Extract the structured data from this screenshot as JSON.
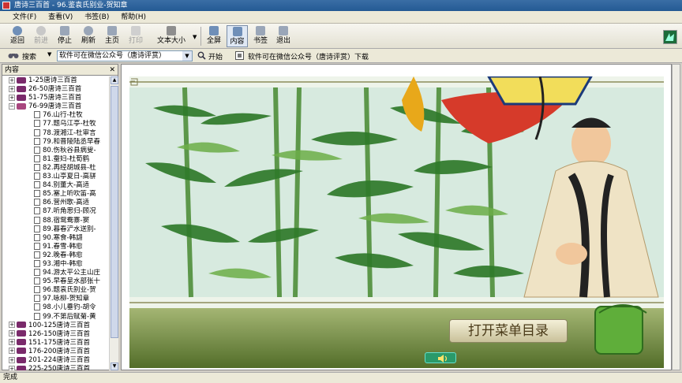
{
  "window": {
    "title": "唐诗三百首 - 96.鉴袁氏别业-贺知章"
  },
  "menu": [
    "文件(F)",
    "查看(V)",
    "书签(B)",
    "帮助(H)"
  ],
  "toolbar": {
    "back": "返回",
    "forward": "前进",
    "stop": "停止",
    "refresh": "刷新",
    "home": "主页",
    "print": "打印",
    "text_size": "文本大小",
    "fullscreen": "全屏",
    "contents": "内容",
    "bookmark": "书签",
    "exit": "退出"
  },
  "searchbar": {
    "search_label": "搜索",
    "combo_value": "软件可在微信公众号（唐诗评赏）",
    "start_label": "开始",
    "download_text": "软件可在微信公众号（唐诗评赏）下载"
  },
  "panel": {
    "title": "内容",
    "close": "✕"
  },
  "tree": [
    {
      "kind": "book",
      "label": "1-25唐诗三百首",
      "expanded": false
    },
    {
      "kind": "book",
      "label": "26-50唐诗三百首",
      "expanded": false
    },
    {
      "kind": "book",
      "label": "51-75唐诗三百首",
      "expanded": false
    },
    {
      "kind": "book",
      "label": "76-99唐诗三百首",
      "expanded": true
    },
    {
      "kind": "leaf",
      "label": "76.山行-杜牧"
    },
    {
      "kind": "leaf",
      "label": "77.题乌江亭-杜牧"
    },
    {
      "kind": "leaf",
      "label": "78.渡湘江-杜审言"
    },
    {
      "kind": "leaf",
      "label": "79.和晋陵陆丞早春"
    },
    {
      "kind": "leaf",
      "label": "80.伤秋谷县病叟-"
    },
    {
      "kind": "leaf",
      "label": "81.蚕妇-杜荀鹤"
    },
    {
      "kind": "leaf",
      "label": "82.再经胡城县-杜"
    },
    {
      "kind": "leaf",
      "label": "83.山亭夏日-高骈"
    },
    {
      "kind": "leaf",
      "label": "84.别董大-高适"
    },
    {
      "kind": "leaf",
      "label": "85.塞上听吹笛-高"
    },
    {
      "kind": "leaf",
      "label": "86.营州歌-高适"
    },
    {
      "kind": "leaf",
      "label": "87.听角思归-顾况"
    },
    {
      "kind": "leaf",
      "label": "88.宿鸳鸯寨-窦"
    },
    {
      "kind": "leaf",
      "label": "89.暮春浐水送别-"
    },
    {
      "kind": "leaf",
      "label": "90.寒食-韩翃"
    },
    {
      "kind": "leaf",
      "label": "91.春雪-韩愈"
    },
    {
      "kind": "leaf",
      "label": "92.晚春-韩愈"
    },
    {
      "kind": "leaf",
      "label": "93.湘中-韩愈"
    },
    {
      "kind": "leaf",
      "label": "94.游太平公主山庄"
    },
    {
      "kind": "leaf",
      "label": "95.早春呈水部张十"
    },
    {
      "kind": "leaf",
      "label": "96.题袁氏别业-贺"
    },
    {
      "kind": "leaf",
      "label": "97.咏柳-贺知章"
    },
    {
      "kind": "leaf",
      "label": "98.小儿垂钓-胡令"
    },
    {
      "kind": "leaf",
      "label": "99.不第后赋菊-黄"
    },
    {
      "kind": "book",
      "label": "100-125唐诗三百首",
      "expanded": false
    },
    {
      "kind": "book",
      "label": "126-150唐诗三百首",
      "expanded": false
    },
    {
      "kind": "book",
      "label": "151-175唐诗三百首",
      "expanded": false
    },
    {
      "kind": "book",
      "label": "176-200唐诗三百首",
      "expanded": false
    },
    {
      "kind": "book",
      "label": "201-224唐诗三百首",
      "expanded": false
    },
    {
      "kind": "book",
      "label": "225-250唐诗三百首",
      "expanded": false
    }
  ],
  "content": {
    "menu_button": "打开菜单目录",
    "speaker_icon": "speaker-icon"
  },
  "status": "完成",
  "colors": {
    "titlebar": "#2a5f97",
    "tree_book": "#7a2a6b",
    "bamboo_dark": "#2f7a2a",
    "bamboo_light": "#6cae48",
    "banner_bottom": "#6f8a3a"
  }
}
